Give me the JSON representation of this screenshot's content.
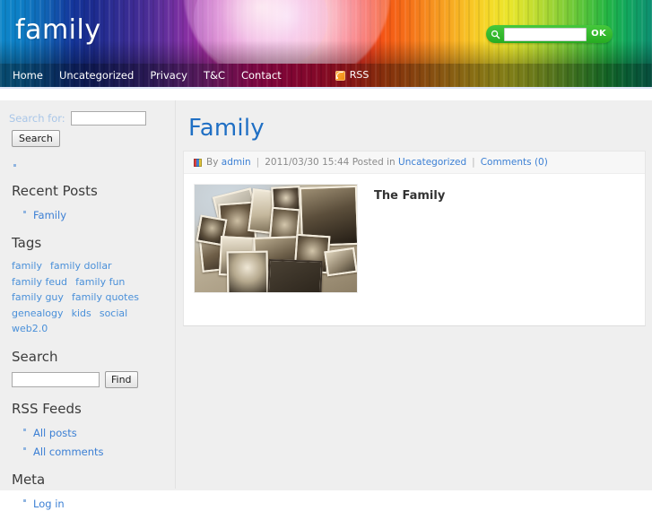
{
  "site": {
    "title": "family",
    "header_search": {
      "value": "",
      "placeholder": "",
      "submit_label": "OK",
      "search_icon": "search-icon"
    }
  },
  "nav": {
    "items": [
      {
        "label": "Home"
      },
      {
        "label": "Uncategorized"
      },
      {
        "label": "Privacy"
      },
      {
        "label": "T&C"
      },
      {
        "label": "Contact"
      }
    ],
    "rss": {
      "label": "RSS",
      "icon": "rss-icon"
    }
  },
  "sidebar": {
    "widget_search": {
      "label": "Search for:",
      "value": "",
      "button_label": "Search"
    },
    "recent_posts": {
      "heading": "Recent Posts",
      "items": [
        {
          "label": "Family"
        }
      ]
    },
    "tags": {
      "heading": "Tags",
      "items": [
        {
          "label": "family"
        },
        {
          "label": "family dollar"
        },
        {
          "label": "family feud"
        },
        {
          "label": "family fun"
        },
        {
          "label": "family guy"
        },
        {
          "label": "family quotes"
        },
        {
          "label": "genealogy"
        },
        {
          "label": "kids"
        },
        {
          "label": "social"
        },
        {
          "label": "web2.0"
        }
      ]
    },
    "search2": {
      "heading": "Search",
      "value": "",
      "button_label": "Find"
    },
    "rss_feeds": {
      "heading": "RSS Feeds",
      "items": [
        {
          "label": "All posts"
        },
        {
          "label": "All comments"
        }
      ]
    },
    "meta": {
      "heading": "Meta",
      "items": [
        {
          "label": "Log in"
        }
      ]
    }
  },
  "post": {
    "title": "Family",
    "meta": {
      "by_label": "By",
      "author": "admin",
      "date": "2011/03/30 15:44",
      "posted_in_label": "Posted in",
      "category": "Uncategorized",
      "comments": "Comments (0)",
      "separator": "|"
    },
    "heading": "The Family",
    "image_alt": "vintage family photographs collage"
  },
  "colors": {
    "link": "#3b7fd4",
    "title": "#1f6fc4",
    "tag": "#4a90d9",
    "sidebar_bg": "#efefef",
    "accent_green": "#27ac22",
    "rss_orange": "#f08a0c"
  }
}
